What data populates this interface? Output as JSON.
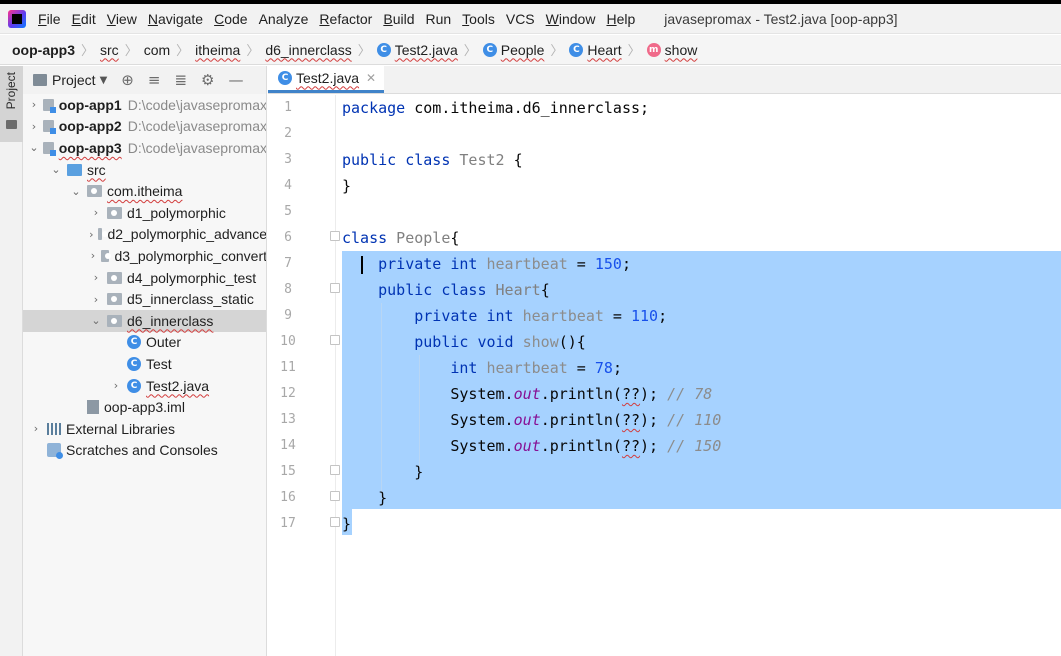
{
  "window": {
    "title": "javasepromax - Test2.java [oop-app3]"
  },
  "menu": [
    {
      "label": "File",
      "mnemonic": "F",
      "rest": "ile"
    },
    {
      "label": "Edit",
      "mnemonic": "E",
      "rest": "dit"
    },
    {
      "label": "View",
      "mnemonic": "V",
      "rest": "iew"
    },
    {
      "label": "Navigate",
      "mnemonic": "N",
      "rest": "avigate"
    },
    {
      "label": "Code",
      "mnemonic": "C",
      "rest": "ode"
    },
    {
      "label": "Analyze",
      "mnemonic": "",
      "rest": "Analyze"
    },
    {
      "label": "Refactor",
      "mnemonic": "R",
      "rest": "efactor"
    },
    {
      "label": "Build",
      "mnemonic": "B",
      "rest": "uild"
    },
    {
      "label": "Run",
      "mnemonic": "",
      "rest": "Run"
    },
    {
      "label": "Tools",
      "mnemonic": "T",
      "rest": "ools"
    },
    {
      "label": "VCS",
      "mnemonic": "",
      "rest": "VCS"
    },
    {
      "label": "Window",
      "mnemonic": "W",
      "rest": "indow"
    },
    {
      "label": "Help",
      "mnemonic": "H",
      "rest": "elp"
    }
  ],
  "breadcrumbs": {
    "project": "oop-app3",
    "src": "src",
    "com": "com",
    "itheima": "itheima",
    "package": "d6_innerclass",
    "file": "Test2.java",
    "class1": "People",
    "class2": "Heart",
    "method": "show"
  },
  "project_panel": {
    "title": "Project",
    "dropdown_icon": "chevron-down-icon",
    "tools": [
      "⊕",
      "≡",
      "≣",
      "⚙",
      "—"
    ],
    "tree": {
      "app1": {
        "name": "oop-app1",
        "path": "D:\\code\\javasepromax"
      },
      "app2": {
        "name": "oop-app2",
        "path": "D:\\code\\javasepromax"
      },
      "app3": {
        "name": "oop-app3",
        "path": "D:\\code\\javasepromax"
      },
      "src": "src",
      "pkg": "com.itheima",
      "d1": "d1_polymorphic",
      "d2": "d2_polymorphic_advance",
      "d3": "d3_polymorphic_convert",
      "d4": "d4_polymorphic_test",
      "d5": "d5_innerclass_static",
      "d6": "d6_innerclass",
      "outer": "Outer",
      "test": "Test",
      "test2": "Test2.java",
      "iml": "oop-app3.iml",
      "libs": "External Libraries",
      "scratches": "Scratches and Consoles"
    }
  },
  "tool_stripe": {
    "project_tab": "Project"
  },
  "editor": {
    "tab": "Test2.java",
    "line_numbers": [
      "1",
      "2",
      "3",
      "4",
      "5",
      "6",
      "7",
      "8",
      "9",
      "10",
      "11",
      "12",
      "13",
      "14",
      "15",
      "16",
      "17"
    ],
    "code": {
      "l1_kw": "package",
      "l1_rest": " com.itheima.d6_innerclass;",
      "l3_kw": "public class",
      "l3_name": " Test2",
      "l3_rest": " {",
      "l4": "}",
      "l6_kw": "class",
      "l6_name": " People",
      "l6_rest": "{",
      "l7_kw": "    private int",
      "l7_field": " heartbeat",
      "l7_eq": " = ",
      "l7_num": "150",
      "l7_end": ";",
      "l8_kw": "    public class",
      "l8_name": " Heart",
      "l8_rest": "{",
      "l9_kw": "        private int",
      "l9_field": " heartbeat",
      "l9_eq": " = ",
      "l9_num": "110",
      "l9_end": ";",
      "l10_kw": "        public void",
      "l10_name": " show",
      "l10_rest": "(){",
      "l11_kw": "            int",
      "l11_field": " heartbeat",
      "l11_eq": " = ",
      "l11_num": "78",
      "l11_end": ";",
      "l12_a": "            System.",
      "l12_out": "out",
      "l12_b": ".println(",
      "l12_q": "??",
      "l12_c": ");",
      "l12_cm": " // 78",
      "l13_a": "            System.",
      "l13_out": "out",
      "l13_b": ".println(",
      "l13_q": "??",
      "l13_c": ");",
      "l13_cm": " // 110",
      "l14_a": "            System.",
      "l14_out": "out",
      "l14_b": ".println(",
      "l14_q": "??",
      "l14_c": ");",
      "l14_cm": " // 150",
      "l15": "        }",
      "l16": "    }",
      "l17": "}"
    }
  },
  "colors": {
    "selection": "#a6d2ff",
    "keyword": "#0033b3",
    "number": "#1750eb",
    "static_field": "#871094",
    "comment": "#8c8c8c",
    "tab_underline": "#4083c9"
  }
}
